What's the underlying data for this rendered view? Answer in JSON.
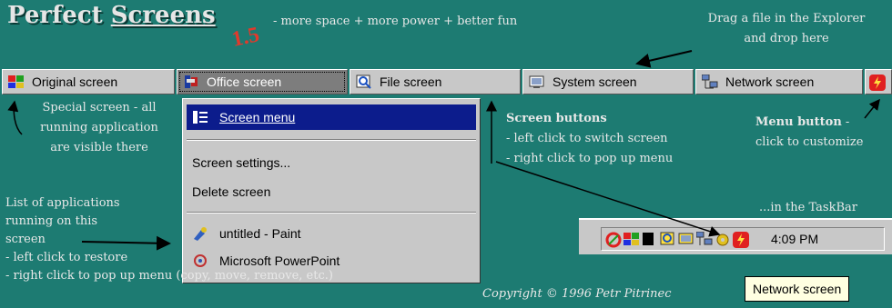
{
  "header": {
    "title_part1": "Perfect ",
    "title_part2": "Screens",
    "version": "1.5",
    "tagline": "- more space + more power + better fun",
    "drop_hint_line1": "Drag a file in the Explorer",
    "drop_hint_line2": "and drop here"
  },
  "tabs": [
    {
      "label": "Original screen",
      "icon": "original-screen-icon"
    },
    {
      "label": "Office screen",
      "icon": "office-screen-icon",
      "active": true
    },
    {
      "label": "File screen",
      "icon": "file-screen-icon"
    },
    {
      "label": "System screen",
      "icon": "system-screen-icon"
    },
    {
      "label": "Network screen",
      "icon": "network-screen-icon"
    }
  ],
  "menu": {
    "items": [
      "Screen menu",
      "Screen settings...",
      "Delete screen",
      "untitled - Paint",
      "Microsoft PowerPoint"
    ]
  },
  "annotations": {
    "special_screen": [
      "Special screen - all",
      "running application",
      "are visible there"
    ],
    "app_list": [
      "List of applications",
      "running on this",
      "screen",
      "- left click to restore",
      "- right click to pop up menu (copy, move, remove, etc.)"
    ],
    "screen_buttons_title": "Screen buttons",
    "screen_buttons": [
      "- left click to switch screen",
      "- right click to pop up menu"
    ],
    "menu_button_title": "Menu button",
    "menu_button_suffix": "-",
    "menu_button_line2": "click to customize",
    "taskbar_hint": "...in the TaskBar",
    "copyright": "Copyright © 1996 Petr Pitrinec"
  },
  "taskbar": {
    "clock": "4:09 PM"
  },
  "tooltip": "Network screen",
  "colors": {
    "background": "#1d7b72",
    "menu_highlight": "#0c1c8c",
    "accent_red": "#e03a2c"
  }
}
